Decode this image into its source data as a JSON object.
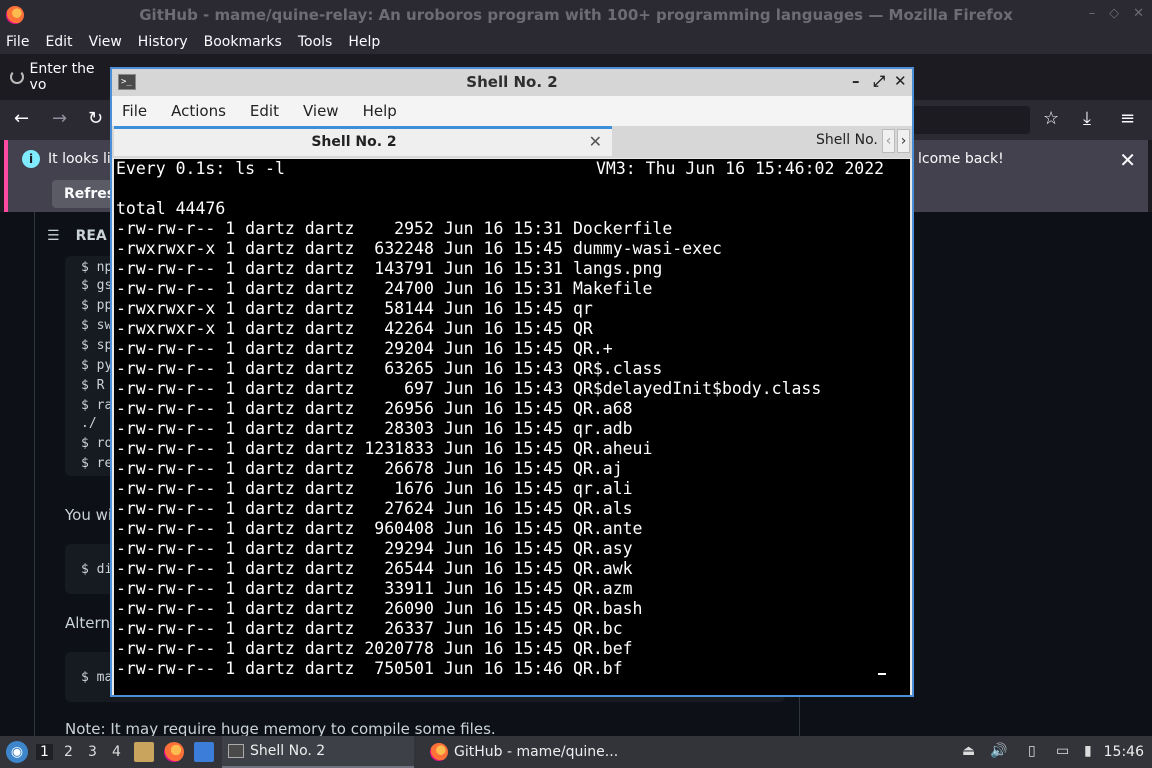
{
  "firefox": {
    "window_title": "GitHub - mame/quine-relay: An uroboros program with 100+ programming languages — Mozilla Firefox",
    "menu": [
      "File",
      "Edit",
      "View",
      "History",
      "Bookmarks",
      "Tools",
      "Help"
    ],
    "tab_label": "Enter the vo",
    "notification_left": "It looks lik",
    "notification_right": "lcome back!",
    "refresh_label": "Refresh",
    "readme_label": "REA",
    "code_prefixes": [
      "$ np",
      "$ gs",
      "$ pp",
      "$ sw",
      "$ sp",
      "$ py",
      "$ R",
      "$ ra",
      "  ./",
      "$ ro",
      "$ re"
    ],
    "text_you": "You wi",
    "code_di": "$ di",
    "text_alt": "Alterna",
    "code_ma": "$ ma",
    "note": "Note: It may require huge memory to compile some files."
  },
  "terminal": {
    "window_title": "Shell No. 2",
    "menu": [
      "File",
      "Actions",
      "Edit",
      "View",
      "Help"
    ],
    "tab_active": "Shell No. 2",
    "tab_second": "Shell No.",
    "header_left": "Every 0.1s: ls -l",
    "header_right": "VM3: Thu Jun 16 15:46:02 2022",
    "total": "total 44476",
    "files": [
      {
        "perm": "-rw-rw-r--",
        "links": "1",
        "user": "dartz",
        "group": "dartz",
        "size": "2952",
        "date": "Jun 16 15:31",
        "name": "Dockerfile"
      },
      {
        "perm": "-rwxrwxr-x",
        "links": "1",
        "user": "dartz",
        "group": "dartz",
        "size": "632248",
        "date": "Jun 16 15:45",
        "name": "dummy-wasi-exec"
      },
      {
        "perm": "-rw-rw-r--",
        "links": "1",
        "user": "dartz",
        "group": "dartz",
        "size": "143791",
        "date": "Jun 16 15:31",
        "name": "langs.png"
      },
      {
        "perm": "-rw-rw-r--",
        "links": "1",
        "user": "dartz",
        "group": "dartz",
        "size": "24700",
        "date": "Jun 16 15:31",
        "name": "Makefile"
      },
      {
        "perm": "-rwxrwxr-x",
        "links": "1",
        "user": "dartz",
        "group": "dartz",
        "size": "58144",
        "date": "Jun 16 15:45",
        "name": "qr"
      },
      {
        "perm": "-rwxrwxr-x",
        "links": "1",
        "user": "dartz",
        "group": "dartz",
        "size": "42264",
        "date": "Jun 16 15:45",
        "name": "QR"
      },
      {
        "perm": "-rw-rw-r--",
        "links": "1",
        "user": "dartz",
        "group": "dartz",
        "size": "29204",
        "date": "Jun 16 15:45",
        "name": "QR.+"
      },
      {
        "perm": "-rw-rw-r--",
        "links": "1",
        "user": "dartz",
        "group": "dartz",
        "size": "63265",
        "date": "Jun 16 15:43",
        "name": "QR$.class"
      },
      {
        "perm": "-rw-rw-r--",
        "links": "1",
        "user": "dartz",
        "group": "dartz",
        "size": "697",
        "date": "Jun 16 15:43",
        "name": "QR$delayedInit$body.class"
      },
      {
        "perm": "-rw-rw-r--",
        "links": "1",
        "user": "dartz",
        "group": "dartz",
        "size": "26956",
        "date": "Jun 16 15:45",
        "name": "QR.a68"
      },
      {
        "perm": "-rw-rw-r--",
        "links": "1",
        "user": "dartz",
        "group": "dartz",
        "size": "28303",
        "date": "Jun 16 15:45",
        "name": "qr.adb"
      },
      {
        "perm": "-rw-rw-r--",
        "links": "1",
        "user": "dartz",
        "group": "dartz",
        "size": "1231833",
        "date": "Jun 16 15:45",
        "name": "QR.aheui"
      },
      {
        "perm": "-rw-rw-r--",
        "links": "1",
        "user": "dartz",
        "group": "dartz",
        "size": "26678",
        "date": "Jun 16 15:45",
        "name": "QR.aj"
      },
      {
        "perm": "-rw-rw-r--",
        "links": "1",
        "user": "dartz",
        "group": "dartz",
        "size": "1676",
        "date": "Jun 16 15:45",
        "name": "qr.ali"
      },
      {
        "perm": "-rw-rw-r--",
        "links": "1",
        "user": "dartz",
        "group": "dartz",
        "size": "27624",
        "date": "Jun 16 15:45",
        "name": "QR.als"
      },
      {
        "perm": "-rw-rw-r--",
        "links": "1",
        "user": "dartz",
        "group": "dartz",
        "size": "960408",
        "date": "Jun 16 15:45",
        "name": "QR.ante"
      },
      {
        "perm": "-rw-rw-r--",
        "links": "1",
        "user": "dartz",
        "group": "dartz",
        "size": "29294",
        "date": "Jun 16 15:45",
        "name": "QR.asy"
      },
      {
        "perm": "-rw-rw-r--",
        "links": "1",
        "user": "dartz",
        "group": "dartz",
        "size": "26544",
        "date": "Jun 16 15:45",
        "name": "QR.awk"
      },
      {
        "perm": "-rw-rw-r--",
        "links": "1",
        "user": "dartz",
        "group": "dartz",
        "size": "33911",
        "date": "Jun 16 15:45",
        "name": "QR.azm"
      },
      {
        "perm": "-rw-rw-r--",
        "links": "1",
        "user": "dartz",
        "group": "dartz",
        "size": "26090",
        "date": "Jun 16 15:45",
        "name": "QR.bash"
      },
      {
        "perm": "-rw-rw-r--",
        "links": "1",
        "user": "dartz",
        "group": "dartz",
        "size": "26337",
        "date": "Jun 16 15:45",
        "name": "QR.bc"
      },
      {
        "perm": "-rw-rw-r--",
        "links": "1",
        "user": "dartz",
        "group": "dartz",
        "size": "2020778",
        "date": "Jun 16 15:45",
        "name": "QR.bef"
      },
      {
        "perm": "-rw-rw-r--",
        "links": "1",
        "user": "dartz",
        "group": "dartz",
        "size": "750501",
        "date": "Jun 16 15:46",
        "name": "QR.bf"
      }
    ]
  },
  "taskbar": {
    "workspaces": [
      "1",
      "2",
      "3",
      "4"
    ],
    "task_shell": "Shell No. 2",
    "task_firefox": "GitHub - mame/quine...",
    "clock": "15:46"
  }
}
